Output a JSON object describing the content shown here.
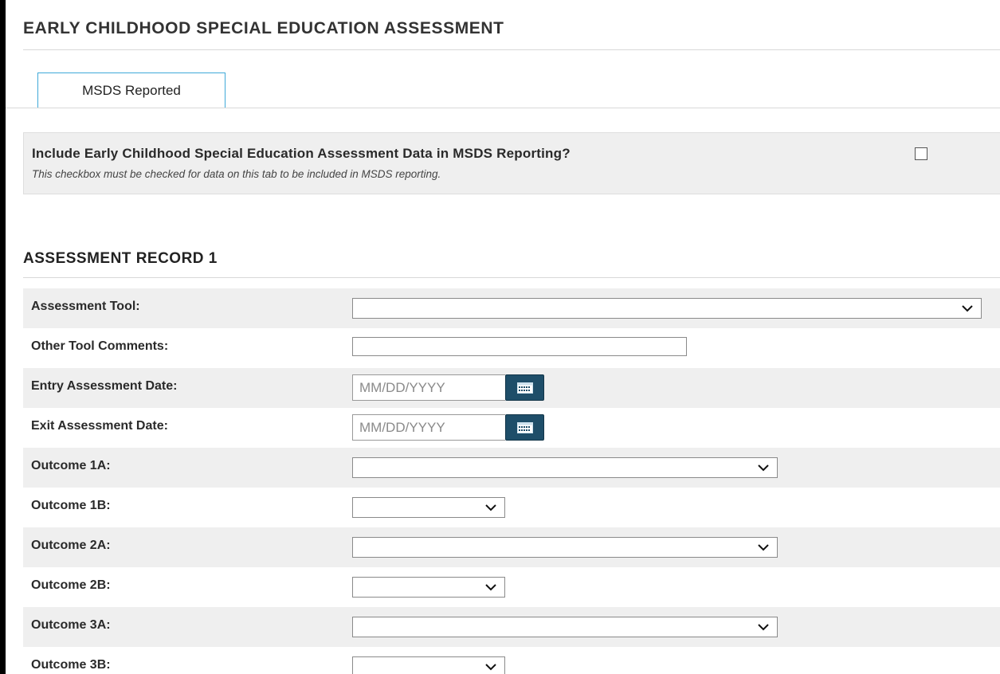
{
  "page": {
    "title": "EARLY CHILDHOOD SPECIAL EDUCATION ASSESSMENT"
  },
  "tabs": [
    {
      "label": "MSDS Reported",
      "active": true
    }
  ],
  "msds": {
    "question": "Include Early Childhood Special Education Assessment Data in MSDS Reporting?",
    "note": "This checkbox must be checked for data on this tab to be included in MSDS reporting.",
    "checked": false
  },
  "record": {
    "title": "ASSESSMENT RECORD 1",
    "fields": [
      {
        "label": "Assessment Tool:",
        "type": "select-wide",
        "value": ""
      },
      {
        "label": "Other Tool Comments:",
        "type": "text",
        "value": ""
      },
      {
        "label": "Entry Assessment Date:",
        "type": "date",
        "placeholder": "MM/DD/YYYY"
      },
      {
        "label": "Exit Assessment Date:",
        "type": "date",
        "placeholder": "MM/DD/YYYY"
      },
      {
        "label": "Outcome 1A:",
        "type": "select-medium",
        "value": ""
      },
      {
        "label": "Outcome 1B:",
        "type": "select-small",
        "value": ""
      },
      {
        "label": "Outcome 2A:",
        "type": "select-medium",
        "value": ""
      },
      {
        "label": "Outcome 2B:",
        "type": "select-small",
        "value": ""
      },
      {
        "label": "Outcome 3A:",
        "type": "select-medium",
        "value": ""
      },
      {
        "label": "Outcome 3B:",
        "type": "select-small",
        "value": ""
      }
    ]
  },
  "icons": {
    "dropdown": "chevron-down-icon",
    "calendar": "calendar-icon"
  },
  "colors": {
    "tab_border": "#3fa9d8",
    "calendar_button": "#1e4e69",
    "row_shade": "#efefef"
  }
}
